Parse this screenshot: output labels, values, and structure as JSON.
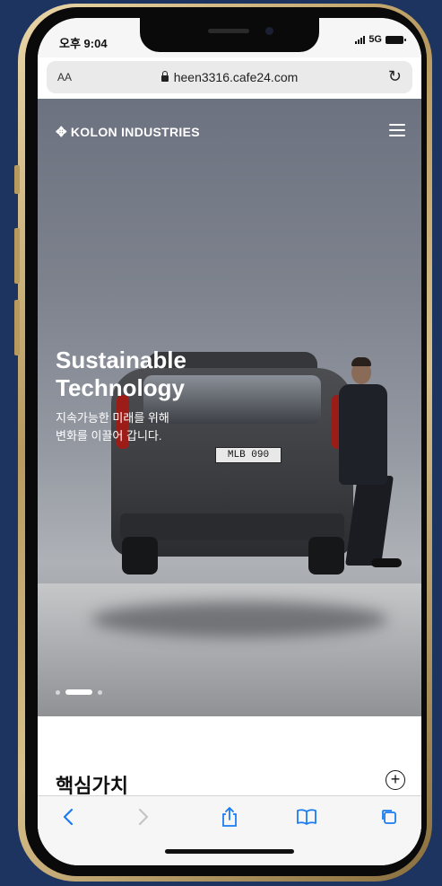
{
  "status_bar": {
    "time": "오후 9:04",
    "network": "5G"
  },
  "browser": {
    "text_size_label": "AA",
    "url": "heen3316.cafe24.com",
    "icons": [
      "lock-icon",
      "reload-icon",
      "back-icon",
      "forward-icon",
      "share-icon",
      "bookmarks-icon",
      "tabs-icon"
    ],
    "accent_color": "#1a7cf0"
  },
  "site": {
    "logo_text": "KOLON INDUSTRIES",
    "hero": {
      "title": "Sustainable\nTechnology",
      "subtitle": "지속가능한 미래를 위해\n변화를 이끌어 갑니다.",
      "plate_text": "MLB 090",
      "slides_count": 3,
      "active_slide": 2
    },
    "section": {
      "title": "핵심가치"
    }
  }
}
